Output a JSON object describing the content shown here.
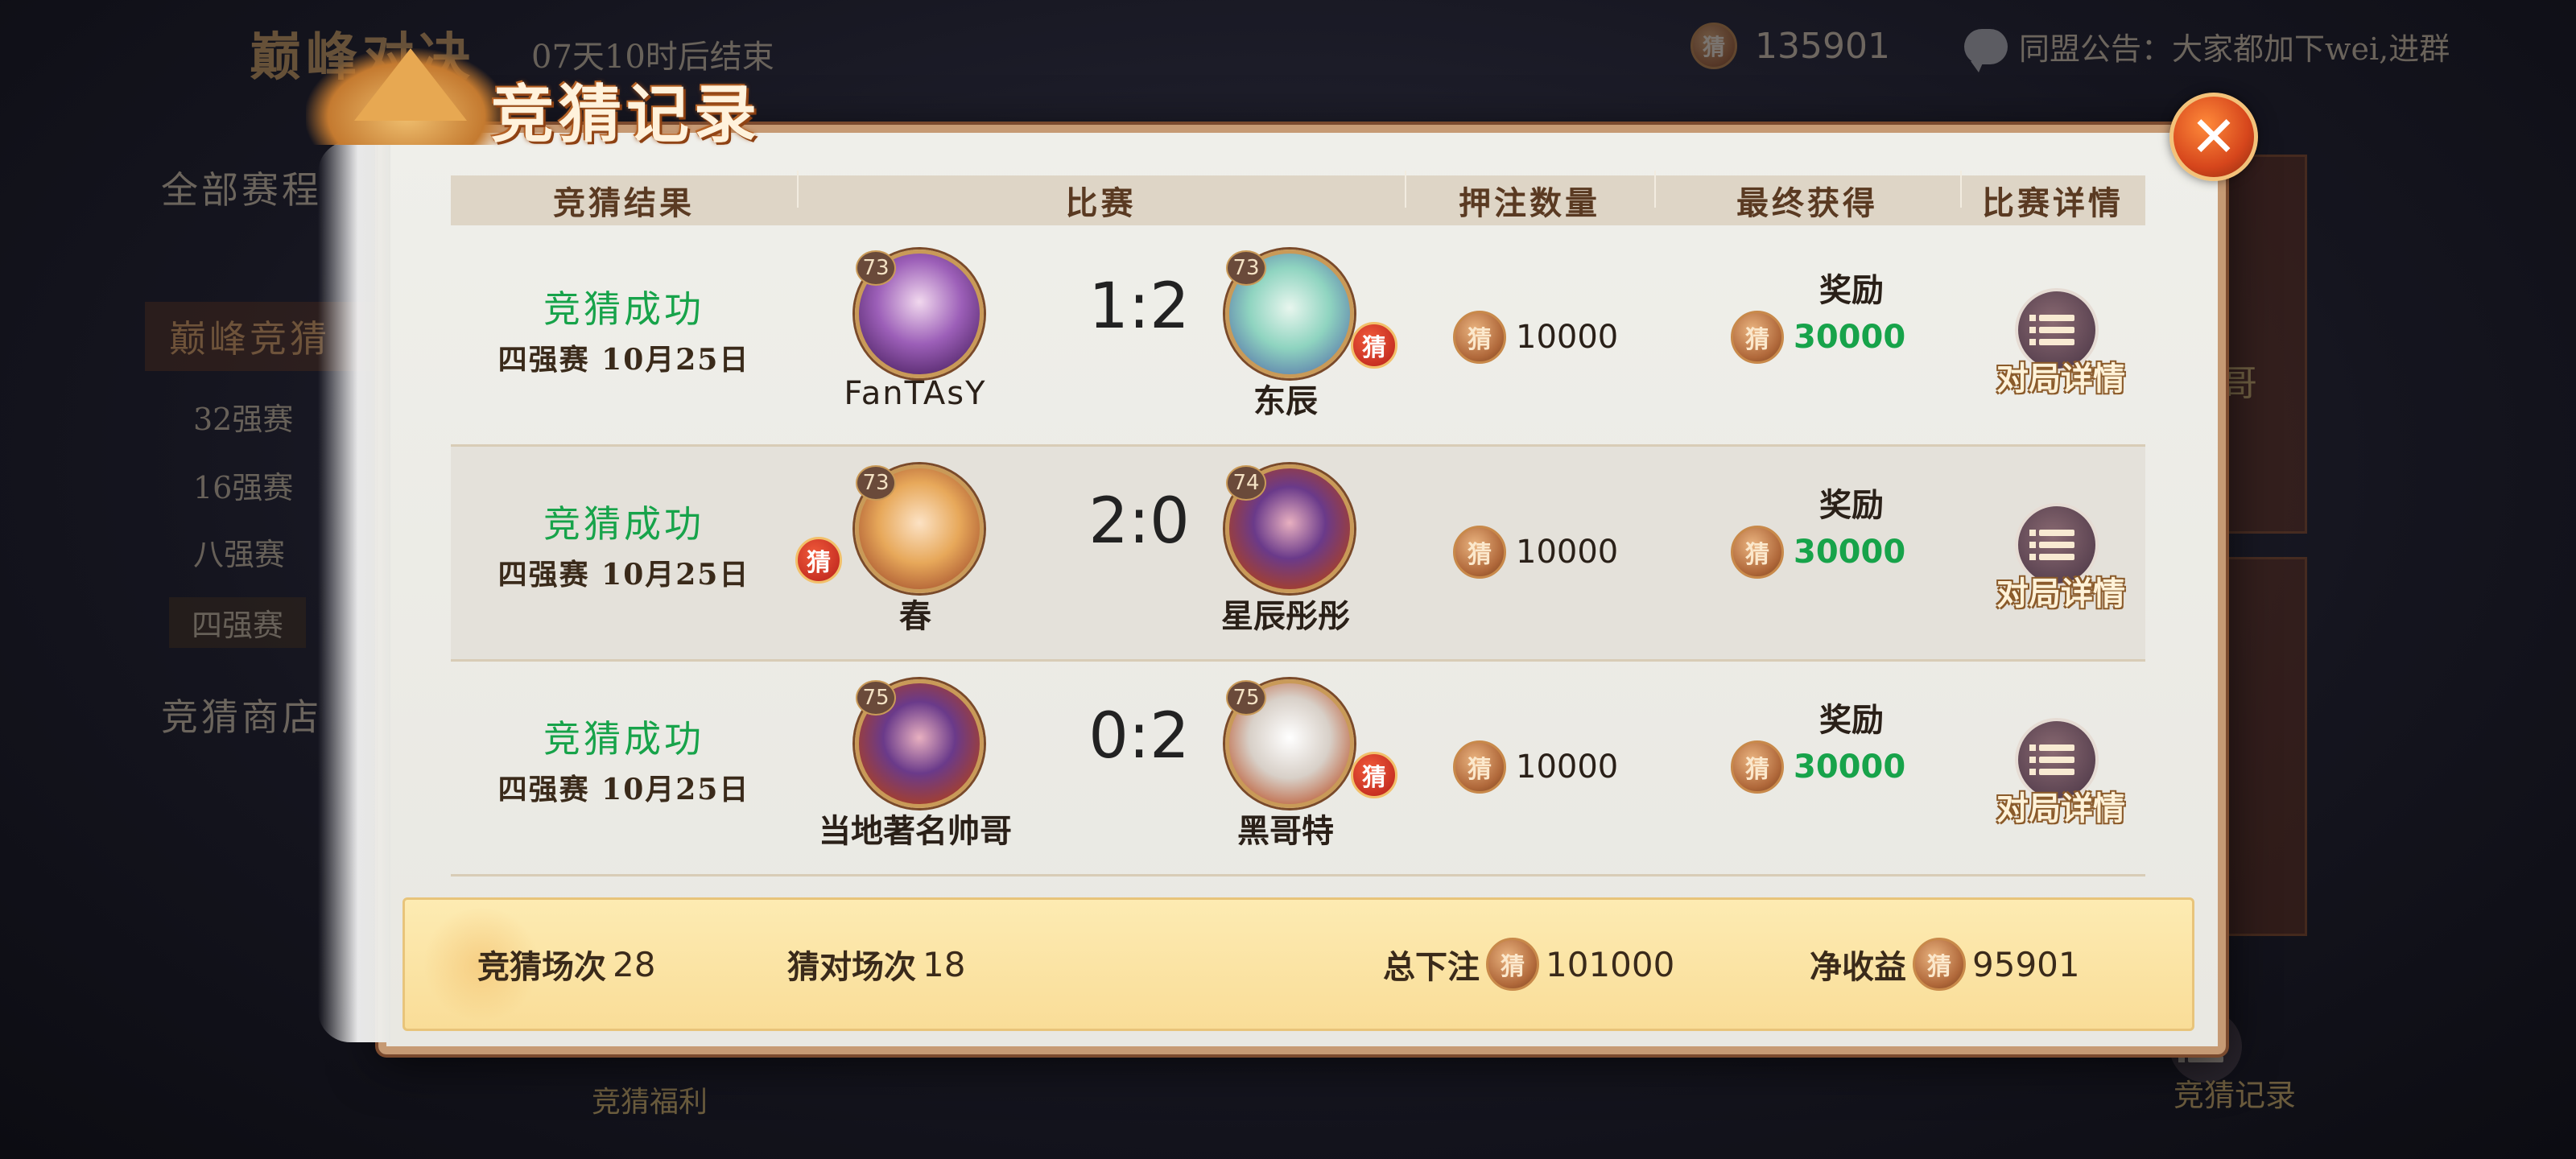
{
  "background": {
    "title": "巅峰对决",
    "countdown": "07天10时后结束",
    "gold": "135901",
    "alliance_notice": "同盟公告：大家都加下wei,进群",
    "sidebar": {
      "all_matches": "全部赛程",
      "peak_quiz": "巅峰竞猜",
      "rounds": [
        "32强赛",
        "16强赛",
        "八强赛",
        "四强赛"
      ],
      "shop": "竞猜商店"
    },
    "welfare": "竞猜福利",
    "right_name": "哥",
    "record_btn": "竞猜记录"
  },
  "modal": {
    "title": "竞猜记录",
    "close_glyph": "✕",
    "headers": [
      "竞猜结果",
      "比赛",
      "押注数量",
      "最终获得",
      "比赛详情"
    ],
    "coin_glyph": "猜",
    "guess_glyph": "猜",
    "reward_label": "奖励",
    "detail_label": "对局详情",
    "rows": [
      {
        "status": "竞猜成功",
        "round": "四强赛  10月25日",
        "left": {
          "name": "FanTAsY",
          "level": "73"
        },
        "right": {
          "name": "东辰",
          "level": "73"
        },
        "score": "1:2",
        "bet": "10000",
        "gain": "30000"
      },
      {
        "status": "竞猜成功",
        "round": "四强赛  10月25日",
        "left": {
          "name": "春",
          "level": "73"
        },
        "right": {
          "name": "星辰彤彤",
          "level": "74"
        },
        "score": "2:0",
        "bet": "10000",
        "gain": "30000"
      },
      {
        "status": "竞猜成功",
        "round": "四强赛  10月25日",
        "left": {
          "name": "当地著名帅哥",
          "level": "75"
        },
        "right": {
          "name": "黑哥特",
          "level": "75"
        },
        "score": "0:2",
        "bet": "10000",
        "gain": "30000"
      }
    ],
    "footer": {
      "quiz_count_label": "竞猜场次",
      "quiz_count": "28",
      "correct_label": "猜对场次",
      "correct": "18",
      "total_bet_label": "总下注",
      "total_bet": "101000",
      "net_label": "净收益",
      "net": "95901"
    }
  },
  "colors": {
    "success": "#17a34a",
    "modal_border": "#c69a74",
    "footer_bg": "#fbe3a4",
    "close": "#d6461c"
  }
}
